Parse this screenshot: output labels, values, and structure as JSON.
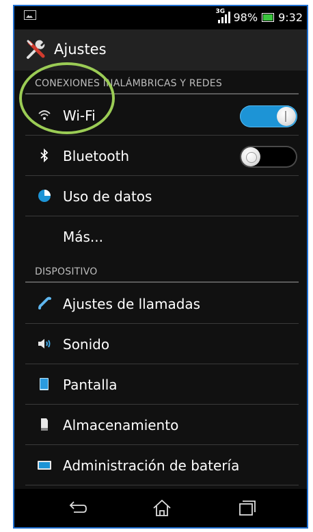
{
  "status_bar": {
    "network_type": "3G",
    "battery_percent": "98%",
    "time": "9:32",
    "colors": {
      "battery_fill": "#39c43d"
    }
  },
  "title_bar": {
    "title": "Ajustes",
    "icon": "settings-tools-icon"
  },
  "sections": [
    {
      "header": "CONEXIONES INALÁMBRICAS Y REDES",
      "items": [
        {
          "label": "Wi-Fi",
          "icon": "wifi-icon",
          "toggle": "on"
        },
        {
          "label": "Bluetooth",
          "icon": "bluetooth-icon",
          "toggle": "off"
        },
        {
          "label": "Uso de datos",
          "icon": "data-usage-icon"
        },
        {
          "label": "Más...",
          "icon": ""
        }
      ]
    },
    {
      "header": "DISPOSITIVO",
      "items": [
        {
          "label": "Ajustes de llamadas",
          "icon": "phone-handset-icon"
        },
        {
          "label": "Sonido",
          "icon": "speaker-icon"
        },
        {
          "label": "Pantalla",
          "icon": "display-icon"
        },
        {
          "label": "Almacenamiento",
          "icon": "storage-icon"
        },
        {
          "label": "Administración de batería",
          "icon": "battery-icon"
        }
      ]
    }
  ],
  "nav_bar": {
    "buttons": [
      "back-icon",
      "home-icon",
      "recent-apps-icon"
    ]
  },
  "colors": {
    "accent": "#1d94d6",
    "highlight_circle": "#9bcc55",
    "frame_border": "#1f6fd0"
  }
}
